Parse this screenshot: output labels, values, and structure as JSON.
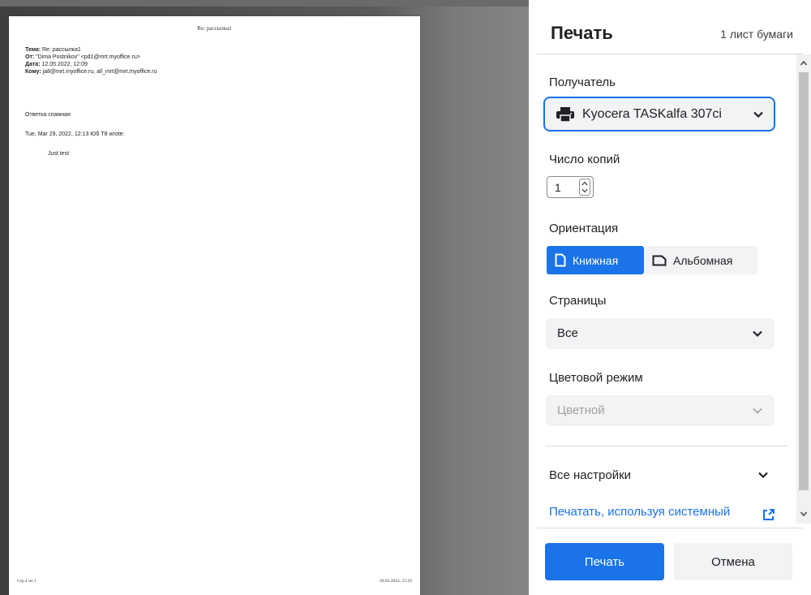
{
  "preview": {
    "page_header": "Re: рассылка1",
    "meta": [
      {
        "key": "Тема:",
        "value": " Re: рассылка1"
      },
      {
        "key": "От:",
        "value": " \"Dima Postnikov\" <pd1@mrt.myoffice.ru>"
      },
      {
        "key": "Дата:",
        "value": " 12.05.2022, 12:09"
      },
      {
        "key": "Кому:",
        "value": " ja8@mrt.myoffice.ru, all_mrt@mrt.myoffice.ru"
      }
    ],
    "reply_text": "Ответка спамная",
    "wrote_line": "Tue, Mar 29, 2022, 12:13 Юб T8 wrote:",
    "quoted_text": "Just test",
    "footer_left": "Стр.1 из 1",
    "footer_right": "20.05.2022, 15:59"
  },
  "panel": {
    "title": "Печать",
    "sheet_count": "1 лист бумаги",
    "destination": {
      "label": "Получатель",
      "value": "Kyocera TASKalfa 307ci",
      "icon": "printer-icon"
    },
    "copies": {
      "label": "Число копий",
      "value": "1"
    },
    "orientation": {
      "label": "Ориентация",
      "portrait": "Книжная",
      "landscape": "Альбомная",
      "selected": "portrait"
    },
    "pages": {
      "label": "Страницы",
      "value": "Все"
    },
    "color_mode": {
      "label": "Цветовой режим",
      "value": "Цветной",
      "disabled": true
    },
    "more_settings": "Все настройки",
    "system_dialog_link": "Печатать, используя системный",
    "print_button": "Печать",
    "cancel_button": "Отмена"
  },
  "colors": {
    "accent": "#1a73e8",
    "field_bg": "#f1f3f4"
  }
}
